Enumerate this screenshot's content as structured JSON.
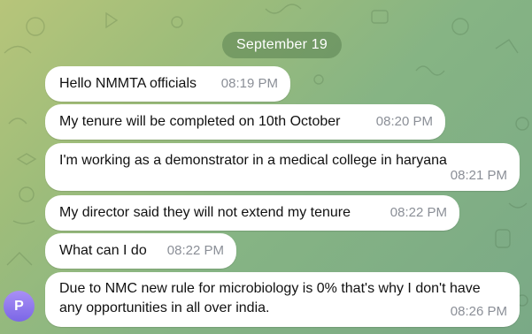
{
  "chat": {
    "date_label": "September 19",
    "sender_avatar_letter": "P",
    "messages": [
      {
        "text": "Hello NMMTA officials",
        "time": "08:19 PM"
      },
      {
        "text": "My tenure will be completed on 10th October",
        "time": "08:20 PM"
      },
      {
        "text": "I'm working as a demonstrator in a medical college in haryana",
        "time": "08:21 PM"
      },
      {
        "text": "My director said they will not extend my tenure",
        "time": "08:22 PM"
      },
      {
        "text": "What can I do",
        "time": "08:22 PM"
      },
      {
        "text": "Due to NMC new rule for microbiology is 0% that's why I don't have\nany opportunities in all over india.",
        "time": "08:26 PM"
      }
    ]
  },
  "colors": {
    "bubble": "#ffffff",
    "timestamp": "#8b8f97",
    "date_pill": "#5a8250",
    "avatar": "#8a74ee"
  }
}
